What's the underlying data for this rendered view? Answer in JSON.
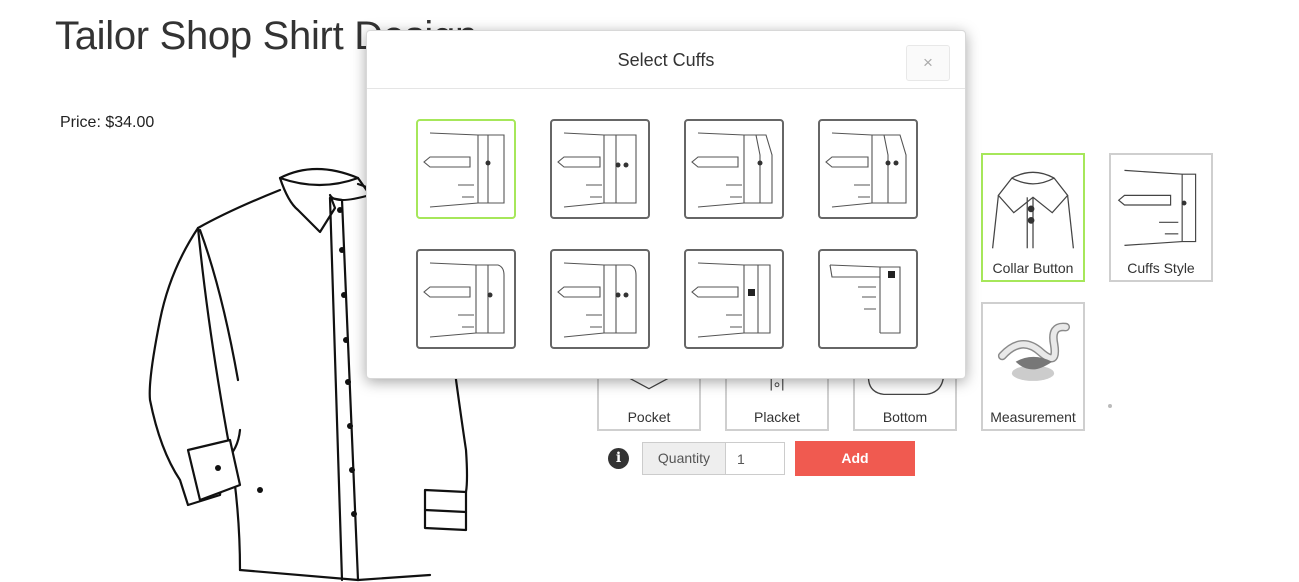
{
  "page": {
    "title": "Tailor Shop Shirt Design",
    "price": "Price: $34.00"
  },
  "options": [
    {
      "label": "Collar Button",
      "icon": "collar-button-icon",
      "selected": true
    },
    {
      "label": "Cuffs Style",
      "icon": "cuff-style-icon",
      "selected": false
    },
    {
      "label": "Pocket",
      "icon": "pocket-icon",
      "selected": false
    },
    {
      "label": "Placket",
      "icon": "placket-icon",
      "selected": false
    },
    {
      "label": "Bottom",
      "icon": "bottom-icon",
      "selected": false
    },
    {
      "label": "Measurement",
      "icon": "measuring-tape-icon",
      "selected": false
    }
  ],
  "quantity": {
    "label": "Quantity",
    "value": "1",
    "add_label": "Add",
    "info_icon": "i"
  },
  "modal": {
    "title": "Select Cuffs",
    "close_label": "×",
    "cuffs": [
      {
        "icon": "single-button-cuff-icon",
        "selected": true
      },
      {
        "icon": "two-button-cuff-icon",
        "selected": false
      },
      {
        "icon": "angled-one-button-cuff-icon",
        "selected": false
      },
      {
        "icon": "angled-two-button-cuff-icon",
        "selected": false
      },
      {
        "icon": "rounded-one-button-cuff-icon",
        "selected": false
      },
      {
        "icon": "rounded-two-button-cuff-icon",
        "selected": false
      },
      {
        "icon": "french-cuff-icon",
        "selected": false
      },
      {
        "icon": "long-french-cuff-icon",
        "selected": false
      }
    ]
  },
  "colors": {
    "accent_selected": "#a6e75a",
    "add_button": "#f05a50",
    "tile_border": "#cfcfcf"
  }
}
